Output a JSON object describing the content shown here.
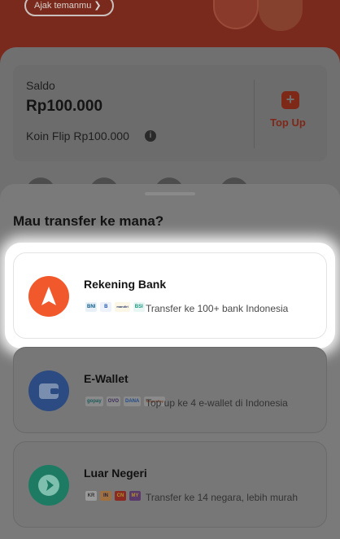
{
  "header": {
    "invite_label": "Ajak temanmu ❯"
  },
  "balance": {
    "saldo_label": "Saldo",
    "saldo_amount": "Rp100.000",
    "koin_label": "Koin Flip Rp100.000",
    "koin_info_glyph": "i",
    "topup_glyph": "+",
    "topup_label": "Top Up"
  },
  "sheet": {
    "title": "Mau transfer ke mana?",
    "options": [
      {
        "title": "Rekening Bank",
        "description": "Transfer ke 100+ bank Indonesia",
        "icon": "paper-plane-icon",
        "icon_color": "#f1582c",
        "logos": [
          "BNI",
          "B",
          "mandiri",
          "BSI"
        ]
      },
      {
        "title": "E-Wallet",
        "description": "Top up ke 4 e-wallet di Indonesia",
        "icon": "wallet-icon",
        "icon_color": "#2b4b82",
        "logos": [
          "gopay",
          "OVO",
          "DANA",
          "ShopeePay"
        ]
      },
      {
        "title": "Luar Negeri",
        "description": "Transfer ke 14 negara, lebih murah",
        "icon": "globe-plane-icon",
        "icon_color": "#1d7a63",
        "logos": [
          "KR",
          "IN",
          "CN",
          "MY"
        ]
      }
    ]
  },
  "colors": {
    "accent": "#f1582c",
    "overlay": "#7a7a7a"
  }
}
